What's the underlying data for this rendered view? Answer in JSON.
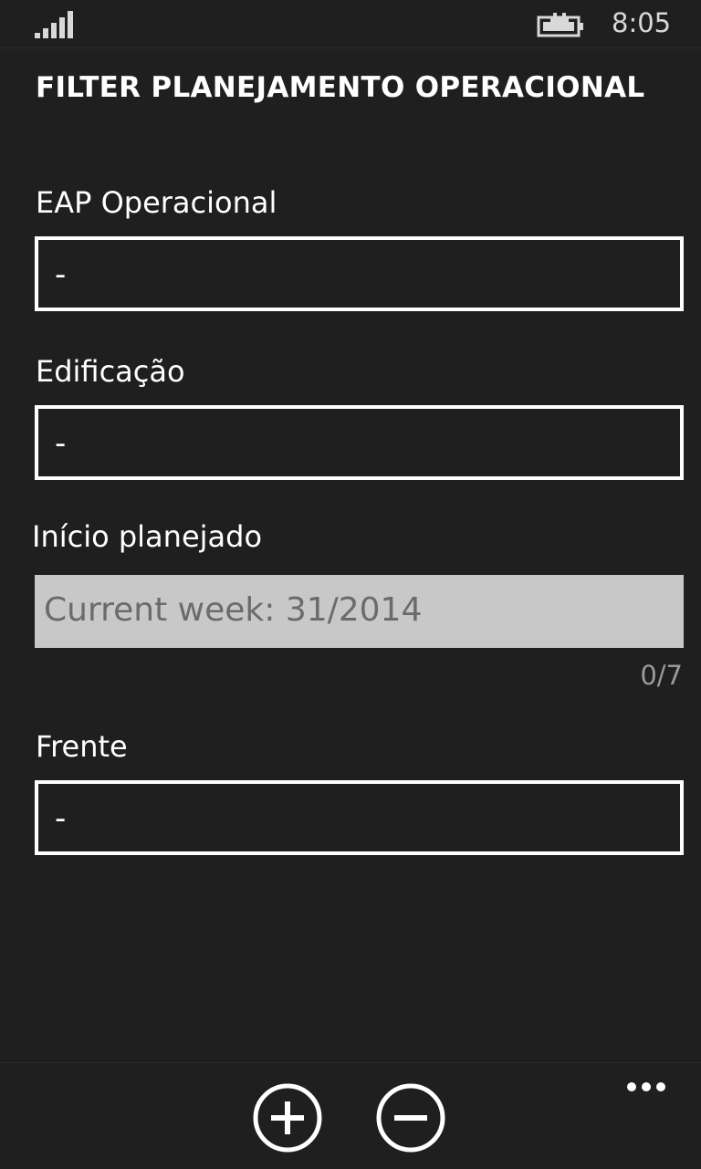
{
  "status": {
    "time": "8:05",
    "signal": "signal-icon",
    "battery": "battery-charging-icon"
  },
  "page": {
    "title": "FILTER PLANEJAMENTO OPERACIONAL"
  },
  "fields": [
    {
      "label": "EAP Operacional",
      "value": "-"
    },
    {
      "label": "Edificação",
      "value": "-"
    },
    {
      "label": "Início planejado",
      "placeholder": "Current week: 31/2014",
      "counter": "0/7"
    },
    {
      "label": "Frente",
      "value": "-"
    }
  ],
  "appbar": {
    "add": "add-icon",
    "remove": "remove-icon",
    "more": "more-icon",
    "colors": {
      "background": "#1f1f1f",
      "foreground": "#ffffff",
      "disabled_field": "#c8c8c8"
    }
  }
}
